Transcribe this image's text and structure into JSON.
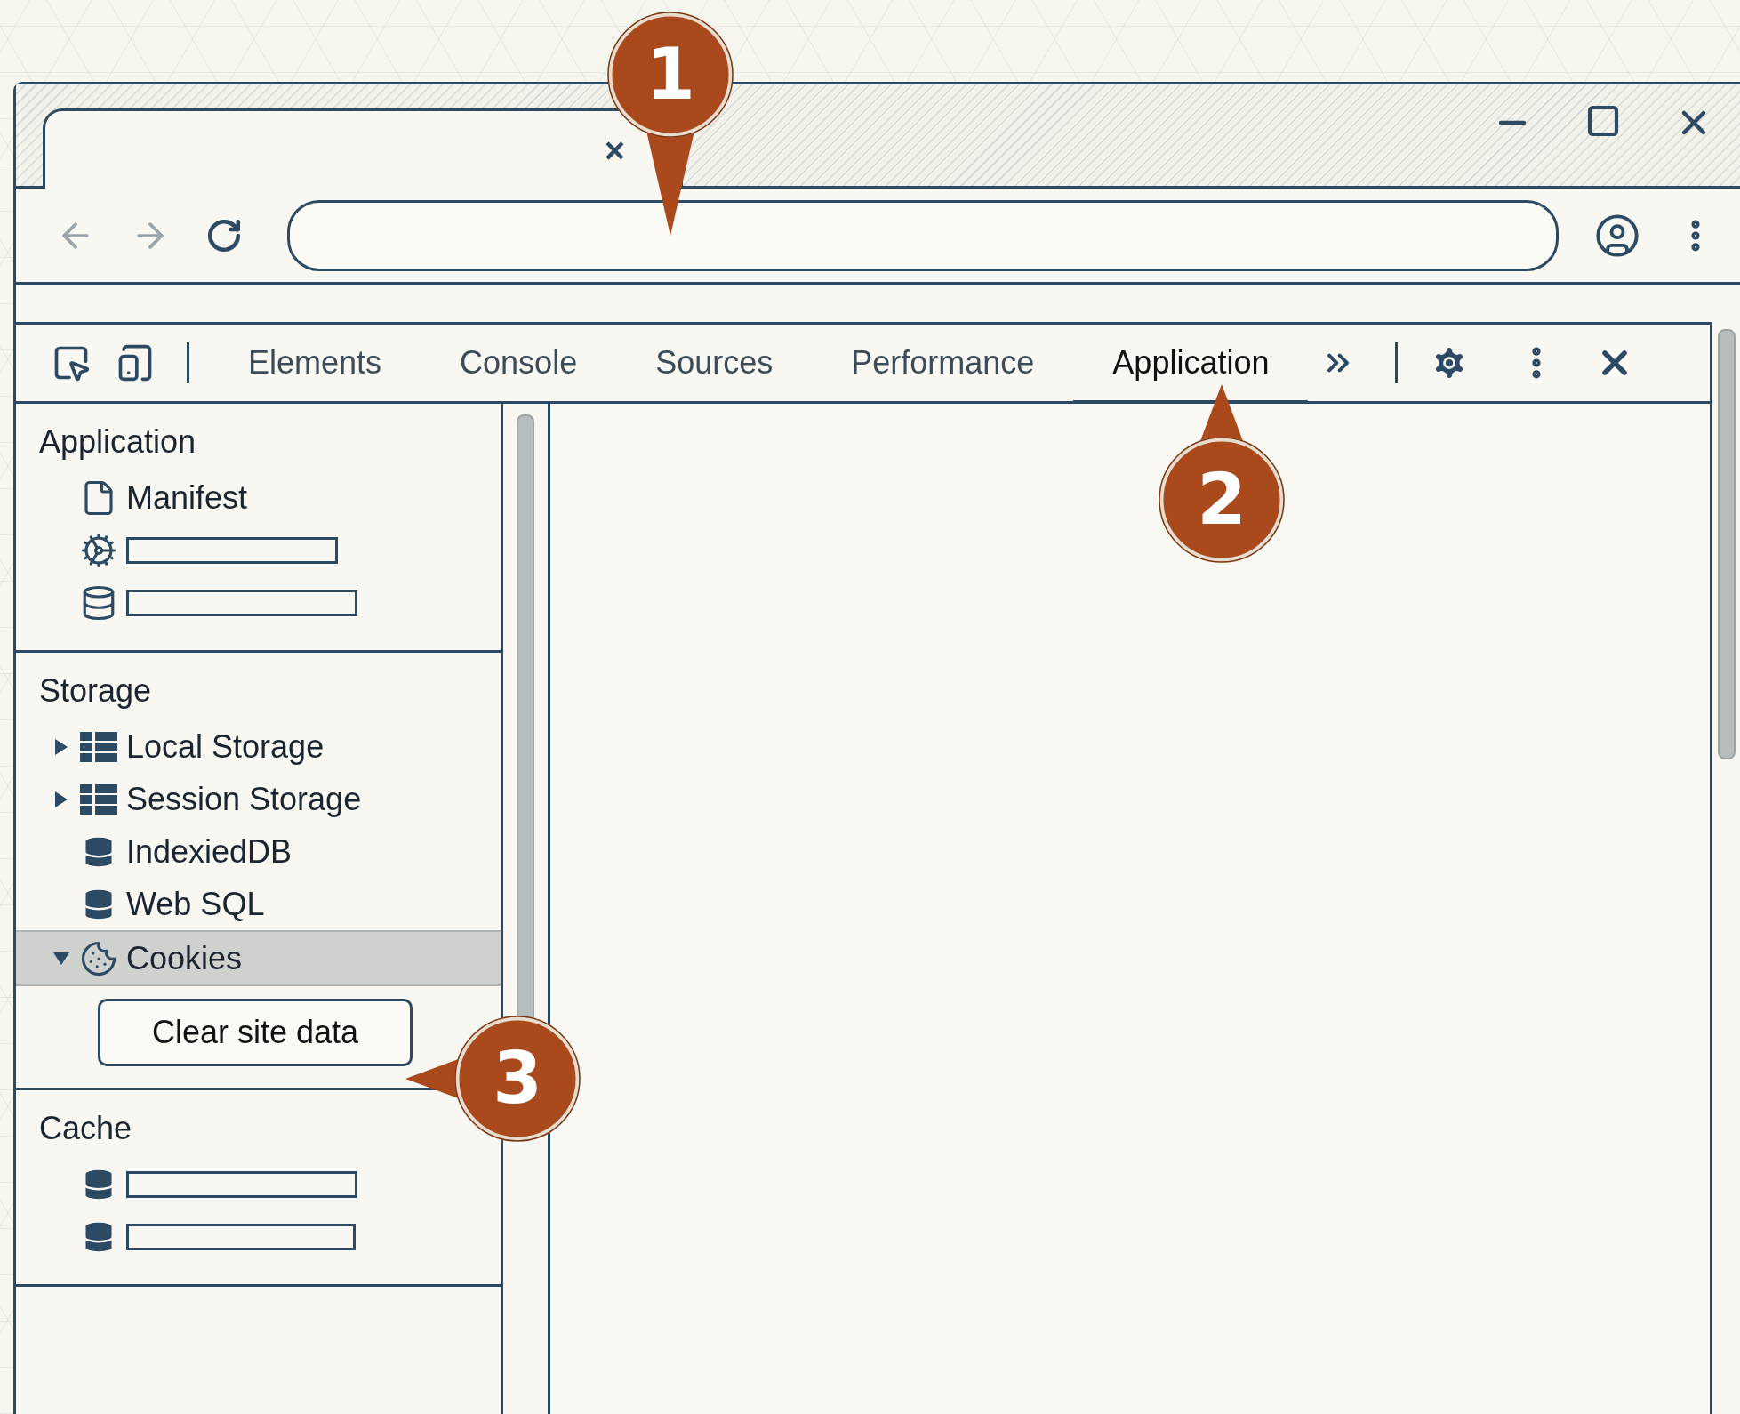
{
  "browser": {
    "tab": {
      "close": "×"
    }
  },
  "devtools": {
    "tabs": [
      {
        "label": "Elements",
        "selected": false
      },
      {
        "label": "Console",
        "selected": false
      },
      {
        "label": "Sources",
        "selected": false
      },
      {
        "label": "Performance",
        "selected": false
      },
      {
        "label": "Application",
        "selected": true
      }
    ],
    "sidebar": {
      "sections": [
        {
          "title": "Application",
          "items": [
            {
              "kind": "document",
              "label": "Manifest",
              "selected": false
            },
            {
              "kind": "service",
              "selected": false
            },
            {
              "kind": "database",
              "selected": false
            }
          ]
        },
        {
          "title": "Storage",
          "items": [
            {
              "kind": "table",
              "label": "Local Storage",
              "expanded": false,
              "selected": false
            },
            {
              "kind": "table",
              "label": "Session Storage",
              "expanded": false,
              "selected": false
            },
            {
              "kind": "database",
              "label": "IndexiedDB",
              "selected": false
            },
            {
              "kind": "database",
              "label": "Web SQL",
              "selected": false
            },
            {
              "kind": "cookies",
              "label": "Cookies",
              "expanded": true,
              "selected": true
            }
          ],
          "button": "Clear site data"
        },
        {
          "title": "Cache",
          "items": [
            {
              "kind": "database",
              "selected": false
            },
            {
              "kind": "database",
              "selected": false
            }
          ]
        }
      ]
    }
  },
  "callouts": [
    {
      "label": "1"
    },
    {
      "label": "2"
    },
    {
      "label": "3"
    }
  ]
}
